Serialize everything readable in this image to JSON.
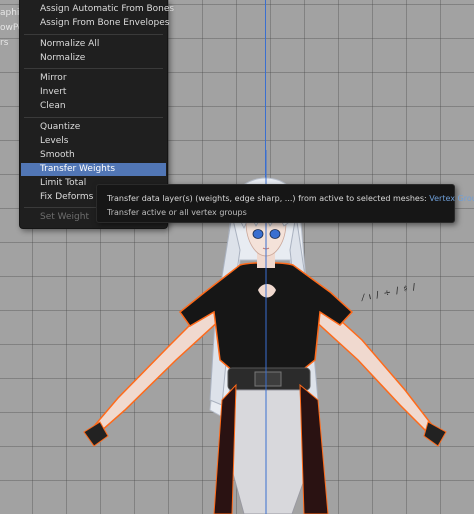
{
  "sidebar": {
    "fragments": [
      "aphic",
      "owPo",
      "rs"
    ]
  },
  "menu": {
    "items": [
      {
        "label": "Assign Automatic From Bones"
      },
      {
        "label": "Assign From Bone Envelopes"
      },
      {
        "label": "Normalize All"
      },
      {
        "label": "Normalize"
      },
      {
        "label": "Mirror"
      },
      {
        "label": "Invert"
      },
      {
        "label": "Clean"
      },
      {
        "label": "Quantize"
      },
      {
        "label": "Levels"
      },
      {
        "label": "Smooth"
      },
      {
        "label": "Transfer Weights",
        "state": "highlighted"
      },
      {
        "label": "Limit Total"
      },
      {
        "label": "Fix Deforms"
      },
      {
        "label": "Set Weight",
        "state": "disabled"
      }
    ]
  },
  "tooltip": {
    "description": "Transfer data layer(s) (weights, edge sharp, ...) from active to selected meshes:",
    "value": "Vertex Group(s)",
    "subtitle": "Transfer active or all vertex groups"
  },
  "colors": {
    "menu_bg": "#1f1f1f",
    "highlight": "#5176b5",
    "axis": "#3a6fd0",
    "outline": "#ff6a1a",
    "viewport_bg": "#a2a2a2"
  },
  "icons": {
    "stroke_marks": "scribble"
  }
}
